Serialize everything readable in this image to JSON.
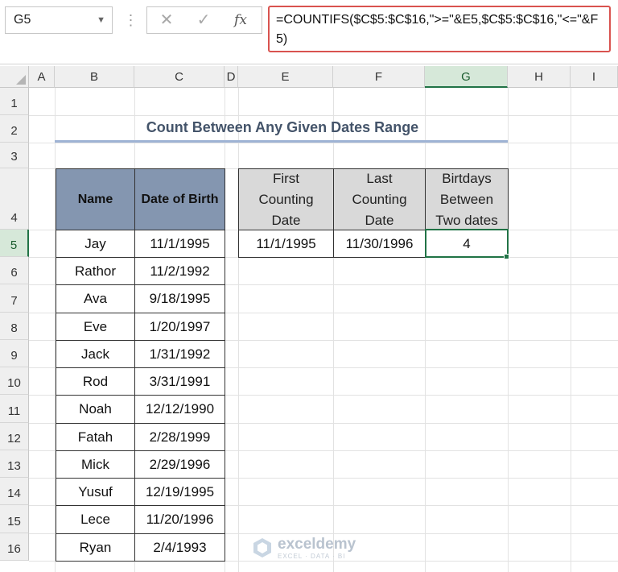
{
  "name_box": {
    "value": "G5",
    "arrow_icon": "chevron-down-icon"
  },
  "formula_bar": {
    "cancel_icon": "✕",
    "enter_icon": "✓",
    "fx_label": "fx",
    "formula": "=COUNTIFS($C$5:$C$16,\">=\"&E5,$C$5:$C$16,\"<=\"&F5)"
  },
  "columns": [
    "A",
    "B",
    "C",
    "D",
    "E",
    "F",
    "G",
    "H",
    "I"
  ],
  "rows": [
    "1",
    "2",
    "3",
    "4",
    "5",
    "6",
    "7",
    "8",
    "9",
    "10",
    "11",
    "12",
    "13",
    "14",
    "15",
    "16"
  ],
  "selected_cell": {
    "column": "G",
    "row": "5"
  },
  "title": "Count Between Any Given Dates Range",
  "dataset": {
    "headers": {
      "name": "Name",
      "dob": "Date of Birth"
    },
    "rows": [
      {
        "name": "Jay",
        "dob": "11/1/1995"
      },
      {
        "name": "Rathor",
        "dob": "11/2/1992"
      },
      {
        "name": "Ava",
        "dob": "9/18/1995"
      },
      {
        "name": "Eve",
        "dob": "1/20/1997"
      },
      {
        "name": "Jack",
        "dob": "1/31/1992"
      },
      {
        "name": "Rod",
        "dob": "3/31/1991"
      },
      {
        "name": "Noah",
        "dob": "12/12/1990"
      },
      {
        "name": "Fatah",
        "dob": "2/28/1999"
      },
      {
        "name": "Mick",
        "dob": "2/29/1996"
      },
      {
        "name": "Yusuf",
        "dob": "12/19/1995"
      },
      {
        "name": "Lece",
        "dob": "11/20/1996"
      },
      {
        "name": "Ryan",
        "dob": "2/4/1993"
      }
    ]
  },
  "criteria": {
    "headers": {
      "first": [
        "First",
        "Counting",
        "Date"
      ],
      "last": [
        "Last",
        "Counting",
        "Date"
      ],
      "result": [
        "Birtdays",
        "Between",
        "Two dates"
      ]
    },
    "first_date": "11/1/1995",
    "last_date": "11/30/1996",
    "result": "4"
  },
  "watermark": {
    "name": "exceldemy",
    "tagline": "EXCEL · DATA · BI"
  },
  "colors": {
    "accent": "#217346",
    "header_fill": "#8496b0",
    "title": "#44546a",
    "formula_border": "#d9534f"
  }
}
